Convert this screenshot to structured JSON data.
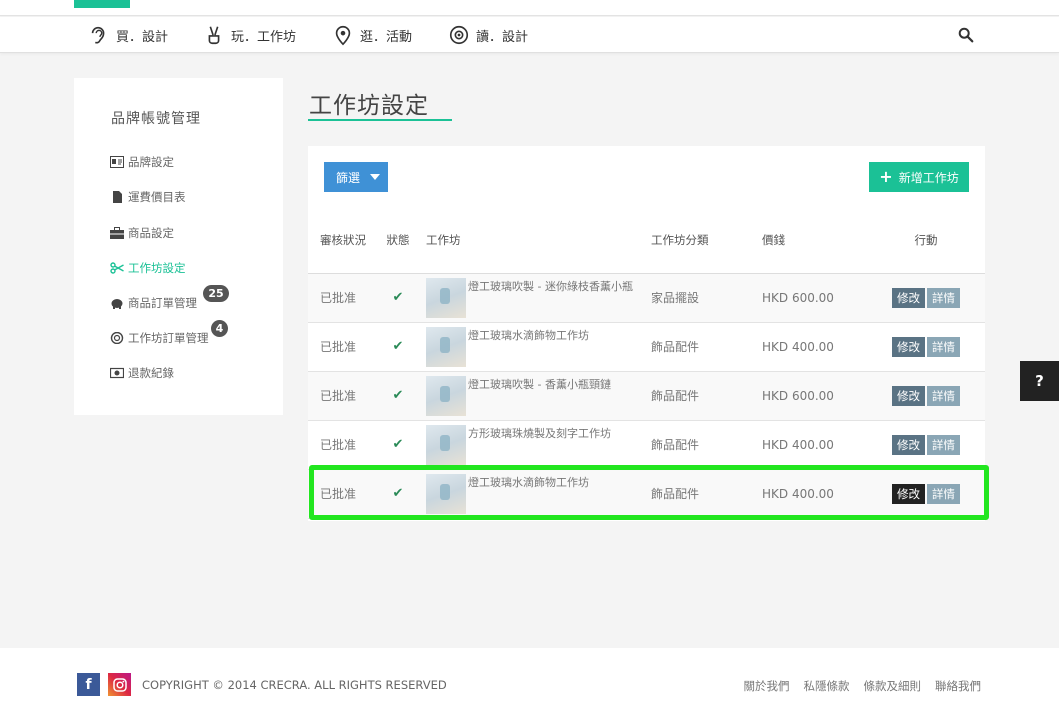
{
  "nav": {
    "items": [
      {
        "label": "買．設計",
        "icon": "ear-icon"
      },
      {
        "label": "玩．工作坊",
        "icon": "peace-hand-icon"
      },
      {
        "label": "逛．活動",
        "icon": "location-pin-icon"
      },
      {
        "label": "讀．設計",
        "icon": "eye-icon"
      }
    ],
    "search_icon": "search-icon"
  },
  "sidebar": {
    "title": "品牌帳號管理",
    "items": [
      {
        "label": "品牌設定",
        "icon": "id-card-icon"
      },
      {
        "label": "運費價目表",
        "icon": "document-icon"
      },
      {
        "label": "商品設定",
        "icon": "briefcase-icon"
      },
      {
        "label": "工作坊設定",
        "icon": "scissors-icon",
        "active": true
      },
      {
        "label": "商品訂單管理",
        "icon": "piggy-bank-icon",
        "badge": "25"
      },
      {
        "label": "工作坊訂單管理",
        "icon": "coin-icon",
        "badge": "4"
      },
      {
        "label": "退款紀錄",
        "icon": "money-icon"
      }
    ]
  },
  "page": {
    "title": "工作坊設定",
    "filter_label": "篩選",
    "add_label": "新增工作坊"
  },
  "table": {
    "headers": {
      "status": "審核狀況",
      "state": "狀態",
      "workshop": "工作坊",
      "category": "工作坊分類",
      "price": "價錢",
      "action": "行動"
    },
    "edit_label": "修改",
    "detail_label": "詳情",
    "rows": [
      {
        "status": "已批准",
        "name": "燈工玻璃吹製 - 迷你綠枝香薰小瓶",
        "category": "家品擺設",
        "price": "HKD 600.00"
      },
      {
        "status": "已批准",
        "name": "燈工玻璃水滴飾物工作坊",
        "category": "飾品配件",
        "price": "HKD 400.00"
      },
      {
        "status": "已批准",
        "name": "燈工玻璃吹製 - 香薰小瓶頸鏈",
        "category": "飾品配件",
        "price": "HKD 600.00"
      },
      {
        "status": "已批准",
        "name": "方形玻璃珠燒製及刻字工作坊",
        "category": "飾品配件",
        "price": "HKD 400.00"
      },
      {
        "status": "已批准",
        "name": "燈工玻璃水滴飾物工作坊",
        "category": "飾品配件",
        "price": "HKD 400.00"
      }
    ]
  },
  "help_label": "?",
  "footer": {
    "copyright": "COPYRIGHT © 2014 CRECRA. ALL RIGHTS RESERVED",
    "links": [
      "關於我們",
      "私隱條款",
      "條款及細則",
      "聯絡我們"
    ]
  },
  "colors": {
    "accent": "#1bc196",
    "filter": "#3f91d6",
    "highlight": "#22e61f"
  }
}
